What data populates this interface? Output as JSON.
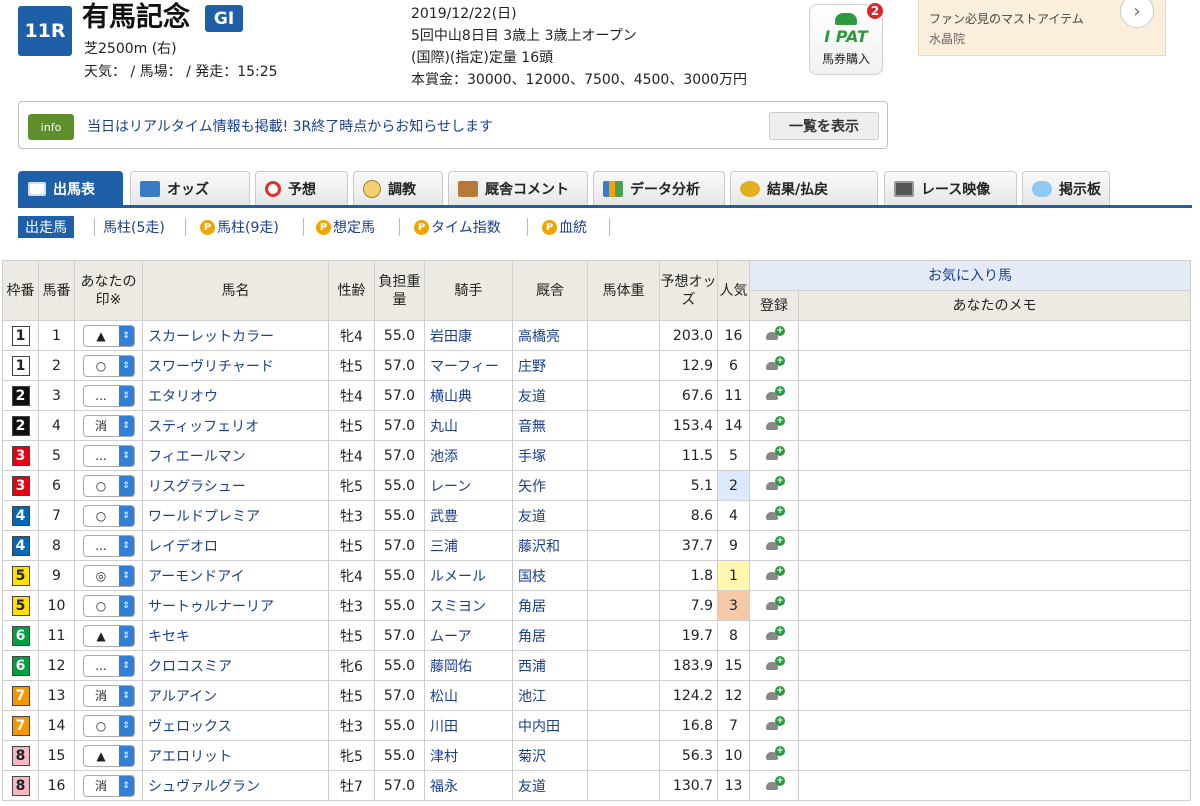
{
  "race": {
    "number": "11R",
    "name": "有馬記念",
    "grade": "GI",
    "course": "芝2500m (右)",
    "conditions": "天気： / 馬場： / 発走：15:25",
    "date": "2019/12/22(日)",
    "meeting": "5回中山8日目 3歳上 3歳上オープン",
    "entry": "(国際)(指定)定量 16頭",
    "prize": "本賞金：30000、12000、7500、4500、3000万円"
  },
  "ipat": {
    "logo": "I PAT",
    "label": "馬券購入"
  },
  "ad": {
    "text": "ファン必見のマストアイテム",
    "sub": "水晶院",
    "next": "›"
  },
  "notice": {
    "tag": "info",
    "text": "当日はリアルタイム情報も掲載! 3R終了時点からお知らせします",
    "button": "一覧を表示",
    "count": "2"
  },
  "tabs": [
    "出馬表",
    "オッズ",
    "予想",
    "調教",
    "厩舎コメント",
    "データ分析",
    "結果/払戻",
    "レース映像",
    "掲示板"
  ],
  "subnav": [
    "出走馬",
    "馬柱(5走)",
    "馬柱(9走)",
    "想定馬",
    "タイム指数",
    "血統"
  ],
  "table": {
    "headers": {
      "waku": "枠番",
      "umaban": "馬番",
      "mark": "あなたの印※",
      "name": "馬名",
      "sexage": "性齢",
      "weight": "負担重量",
      "jockey": "騎手",
      "trainer": "厩舎",
      "bodyweight": "馬体重",
      "odds": "予想オッズ",
      "pop": "人気",
      "fav": "お気に入り馬",
      "reg": "登録",
      "memo": "あなたのメモ"
    },
    "rows": [
      {
        "waku": "1",
        "umaban": "1",
        "mark": "▲",
        "name": "スカーレットカラー",
        "sexage": "牝4",
        "weight": "55.0",
        "jockey": "岩田康",
        "trainer": "高橋亮",
        "odds": "203.0",
        "pop": "16"
      },
      {
        "waku": "1",
        "umaban": "2",
        "mark": "○",
        "name": "スワーヴリチャード",
        "sexage": "牡5",
        "weight": "57.0",
        "jockey": "マーフィー",
        "trainer": "庄野",
        "odds": "12.9",
        "pop": "6"
      },
      {
        "waku": "2",
        "umaban": "3",
        "mark": "...",
        "name": "エタリオウ",
        "sexage": "牡4",
        "weight": "57.0",
        "jockey": "横山典",
        "trainer": "友道",
        "odds": "67.6",
        "pop": "11"
      },
      {
        "waku": "2",
        "umaban": "4",
        "mark": "消",
        "name": "スティッフェリオ",
        "sexage": "牡5",
        "weight": "57.0",
        "jockey": "丸山",
        "trainer": "音無",
        "odds": "153.4",
        "pop": "14"
      },
      {
        "waku": "3",
        "umaban": "5",
        "mark": "...",
        "name": "フィエールマン",
        "sexage": "牡4",
        "weight": "57.0",
        "jockey": "池添",
        "trainer": "手塚",
        "odds": "11.5",
        "pop": "5"
      },
      {
        "waku": "3",
        "umaban": "6",
        "mark": "○",
        "name": "リスグラシュー",
        "sexage": "牝5",
        "weight": "55.0",
        "jockey": "レーン",
        "trainer": "矢作",
        "odds": "5.1",
        "pop": "2"
      },
      {
        "waku": "4",
        "umaban": "7",
        "mark": "○",
        "name": "ワールドプレミア",
        "sexage": "牡3",
        "weight": "55.0",
        "jockey": "武豊",
        "trainer": "友道",
        "odds": "8.6",
        "pop": "4"
      },
      {
        "waku": "4",
        "umaban": "8",
        "mark": "...",
        "name": "レイデオロ",
        "sexage": "牡5",
        "weight": "57.0",
        "jockey": "三浦",
        "trainer": "藤沢和",
        "odds": "37.7",
        "pop": "9"
      },
      {
        "waku": "5",
        "umaban": "9",
        "mark": "◎",
        "name": "アーモンドアイ",
        "sexage": "牝4",
        "weight": "55.0",
        "jockey": "ルメール",
        "trainer": "国枝",
        "odds": "1.8",
        "pop": "1"
      },
      {
        "waku": "5",
        "umaban": "10",
        "mark": "○",
        "name": "サートゥルナーリア",
        "sexage": "牡3",
        "weight": "55.0",
        "jockey": "スミヨン",
        "trainer": "角居",
        "odds": "7.9",
        "pop": "3"
      },
      {
        "waku": "6",
        "umaban": "11",
        "mark": "▲",
        "name": "キセキ",
        "sexage": "牡5",
        "weight": "57.0",
        "jockey": "ムーア",
        "trainer": "角居",
        "odds": "19.7",
        "pop": "8"
      },
      {
        "waku": "6",
        "umaban": "12",
        "mark": "...",
        "name": "クロコスミア",
        "sexage": "牝6",
        "weight": "55.0",
        "jockey": "藤岡佑",
        "trainer": "西浦",
        "odds": "183.9",
        "pop": "15"
      },
      {
        "waku": "7",
        "umaban": "13",
        "mark": "消",
        "name": "アルアイン",
        "sexage": "牡5",
        "weight": "57.0",
        "jockey": "松山",
        "trainer": "池江",
        "odds": "124.2",
        "pop": "12"
      },
      {
        "waku": "7",
        "umaban": "14",
        "mark": "○",
        "name": "ヴェロックス",
        "sexage": "牡3",
        "weight": "55.0",
        "jockey": "川田",
        "trainer": "中内田",
        "odds": "16.8",
        "pop": "7"
      },
      {
        "waku": "8",
        "umaban": "15",
        "mark": "▲",
        "name": "アエロリット",
        "sexage": "牝5",
        "weight": "55.0",
        "jockey": "津村",
        "trainer": "菊沢",
        "odds": "56.3",
        "pop": "10"
      },
      {
        "waku": "8",
        "umaban": "16",
        "mark": "消",
        "name": "シュヴァルグラン",
        "sexage": "牡7",
        "weight": "57.0",
        "jockey": "福永",
        "trainer": "友道",
        "odds": "130.7",
        "pop": "13"
      }
    ]
  },
  "colors": {
    "primary": "#1f5fa8",
    "link": "#1b3f8f",
    "pop1": "#fff6b0",
    "pop2": "#dce8fb",
    "pop3": "#f5c9a8"
  }
}
